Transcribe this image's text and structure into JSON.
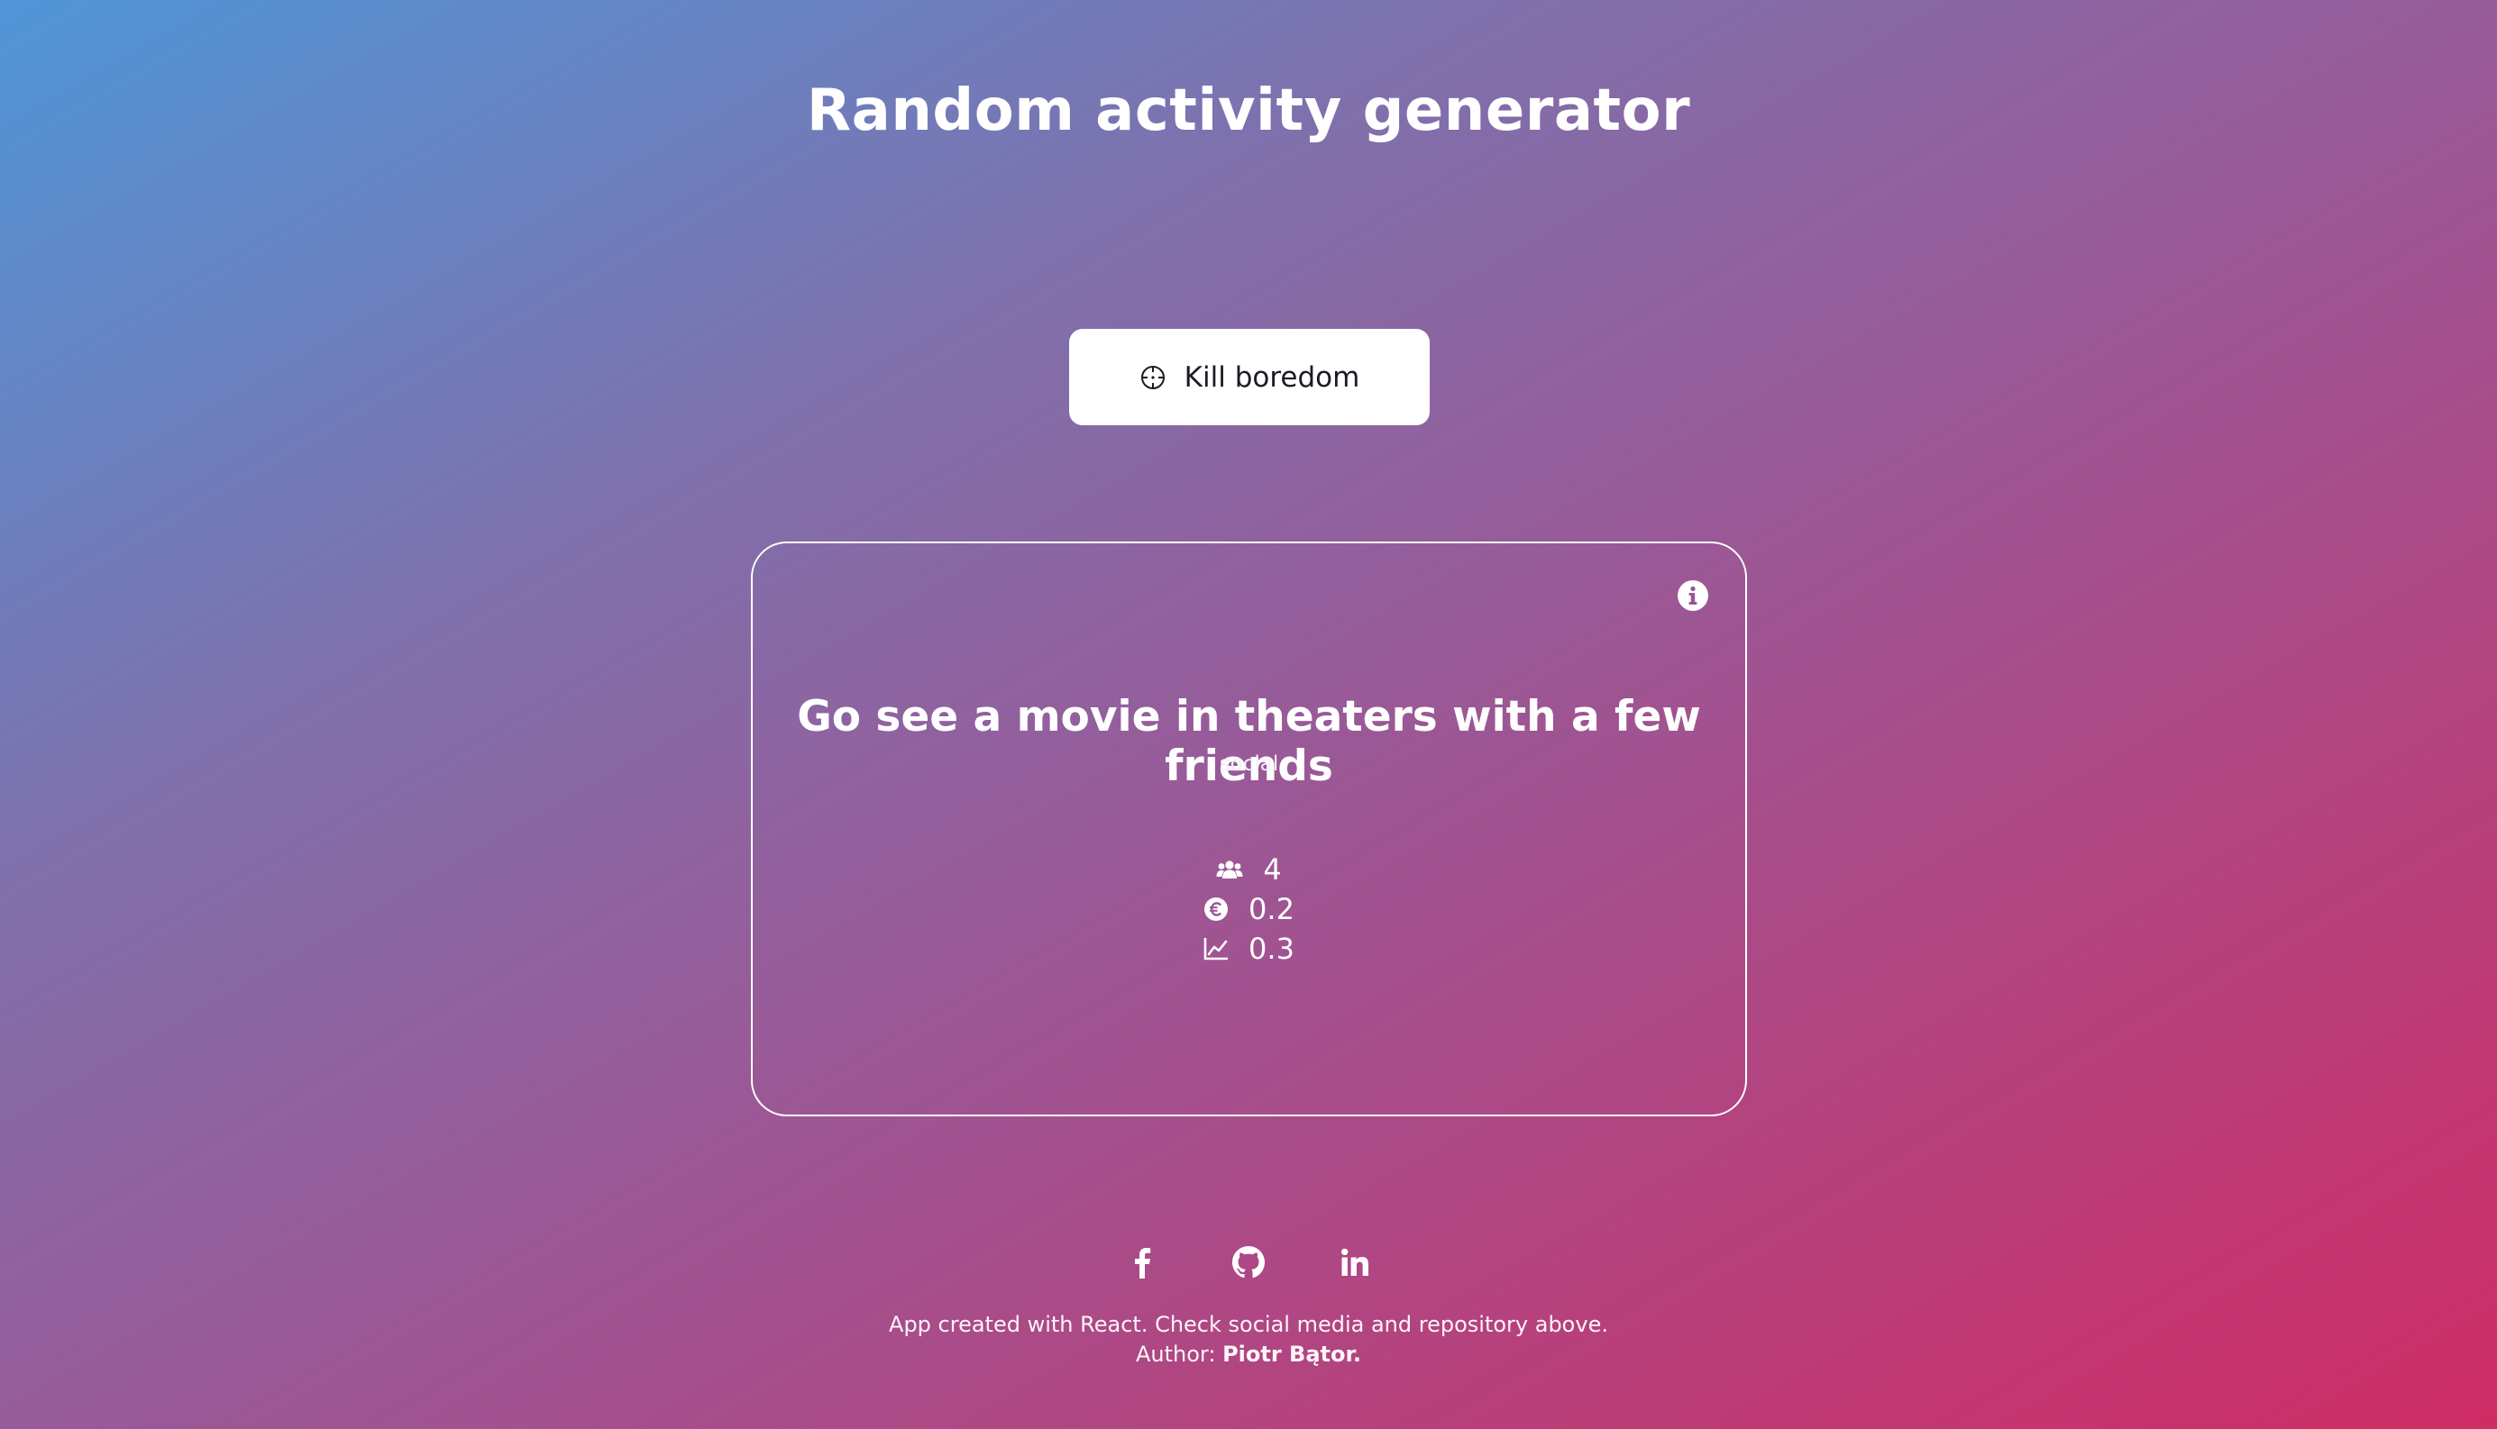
{
  "header": {
    "title": "Random activity generator"
  },
  "action": {
    "button_label": "Kill boredom",
    "button_icon": "crosshair-icon"
  },
  "activity": {
    "title": "Go see a movie in theaters with a few friends",
    "type": "social",
    "info_icon": "info-icon",
    "stats": [
      {
        "icon": "users-icon",
        "value": "4"
      },
      {
        "icon": "euro-coin-icon",
        "value": "0.2"
      },
      {
        "icon": "line-chart-icon",
        "value": "0.3"
      }
    ]
  },
  "footer": {
    "social_icons": [
      "facebook-icon",
      "github-icon",
      "linkedin-icon"
    ],
    "credit_line": "App created with React. Check social media and repository above.",
    "author_label": "Author:",
    "author_name": "Piotr Bątor."
  },
  "colors": {
    "gradient_start": "#4f96d8",
    "gradient_mid": "#a54f8d",
    "gradient_end": "#cf2c64",
    "button_background": "#ffffff",
    "button_text": "#1b1b24",
    "text": "#ffffff"
  }
}
